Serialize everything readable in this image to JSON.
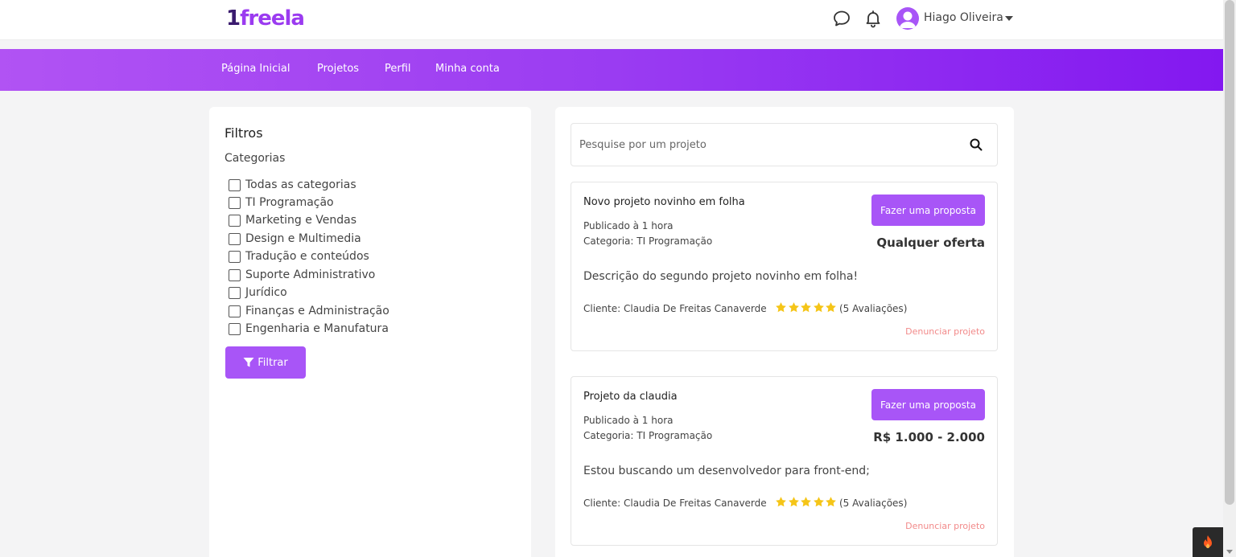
{
  "header": {
    "logo_one": "1",
    "logo_rest": "freela",
    "user_name": "Hiago Oliveira"
  },
  "nav": {
    "items": [
      {
        "label": "Página Inicial"
      },
      {
        "label": "Projetos"
      },
      {
        "label": "Perfil"
      },
      {
        "label": "Minha conta"
      }
    ]
  },
  "filters": {
    "title": "Filtros",
    "categories_title": "Categorias",
    "categories": [
      {
        "label": "Todas as categorias",
        "checked": false
      },
      {
        "label": "TI Programação",
        "checked": false
      },
      {
        "label": "Marketing e Vendas",
        "checked": false
      },
      {
        "label": "Design e Multimedia",
        "checked": false
      },
      {
        "label": "Tradução e conteúdos",
        "checked": false
      },
      {
        "label": "Suporte Administrativo",
        "checked": false
      },
      {
        "label": "Jurídico",
        "checked": false
      },
      {
        "label": "Finanças e Administração",
        "checked": false
      },
      {
        "label": "Engenharia e Manufatura",
        "checked": false
      }
    ],
    "button_label": "Filtrar"
  },
  "search": {
    "placeholder": "Pesquise por um projeto",
    "value": ""
  },
  "projects": [
    {
      "title": "Novo projeto novinho em folha",
      "published": "Publicado à 1 hora",
      "category": "Categoria: TI Programação",
      "proposal_label": "Fazer uma proposta",
      "price": "Qualquer oferta",
      "description": "Descrição do segundo projeto novinho em folha!",
      "client": "Cliente: Claudia De Freitas Canaverde",
      "rating": 5,
      "reviews": "(5 Avaliações)",
      "report_label": "Denunciar projeto"
    },
    {
      "title": "Projeto da claudia",
      "published": "Publicado à 1 hora",
      "category": "Categoria: TI Programação",
      "proposal_label": "Fazer uma proposta",
      "price": "R$ 1.000 - 2.000",
      "description": "Estou buscando um desenvolvedor para front-end;",
      "client": "Cliente: Claudia De Freitas Canaverde",
      "rating": 5,
      "reviews": "(5 Avaliações)",
      "report_label": "Denunciar projeto"
    }
  ],
  "colors": {
    "accent": "#a855f7",
    "nav_start": "#b153f3",
    "nav_end": "#8318f0",
    "star": "#f5c518",
    "report": "#f28a8a"
  }
}
